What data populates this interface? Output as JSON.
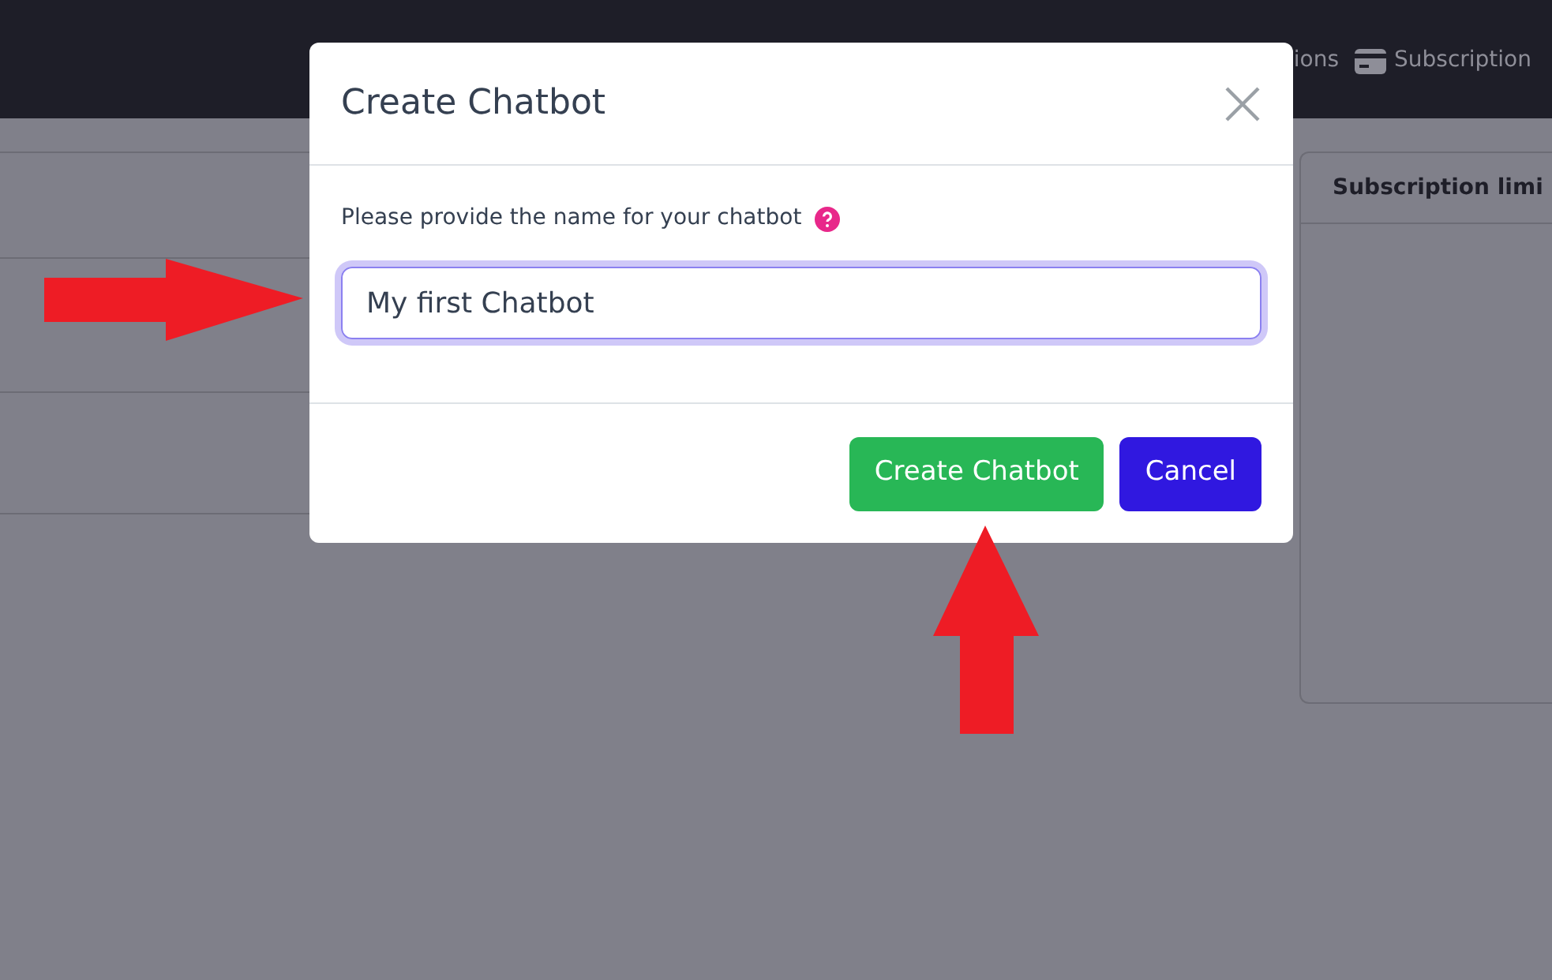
{
  "nav": {
    "items": [
      {
        "label": "ions"
      },
      {
        "label": "Subscription"
      }
    ]
  },
  "side_card": {
    "title": "Subscription limi"
  },
  "dialog": {
    "title": "Create Chatbot",
    "prompt": "Please provide the name for your chatbot",
    "name_field": {
      "value": "My first Chatbot"
    },
    "buttons": [
      {
        "label": "Create Chatbot",
        "kind": "primary"
      },
      {
        "label": "Cancel",
        "kind": "secondary"
      }
    ]
  }
}
